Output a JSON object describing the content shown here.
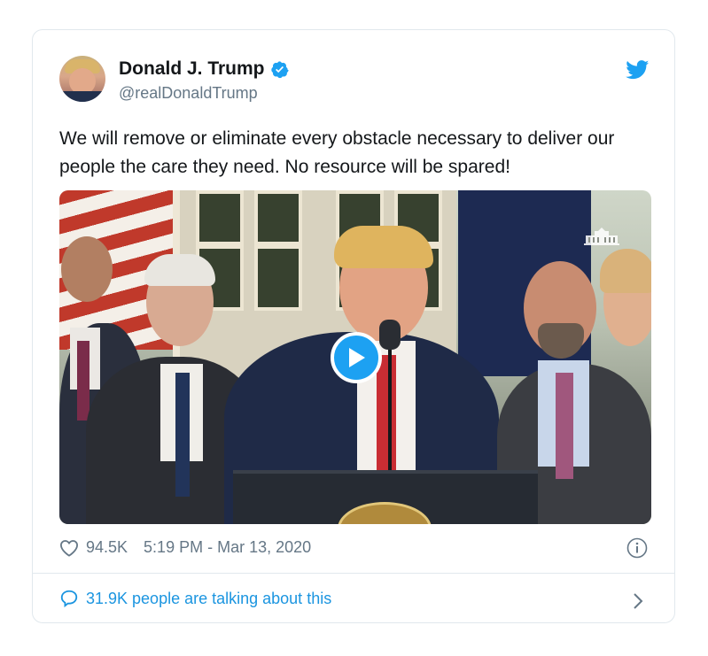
{
  "tweet": {
    "author_name": "Donald J. Trump",
    "author_handle": "@realDonaldTrump",
    "text": "We will remove or eliminate every obstacle necessary to deliver our people the care they need. No resource will be spared!",
    "likes": "94.5K",
    "time": "5:19 PM - Mar 13, 2020",
    "talking": "31.9K people are talking about this",
    "verified": true
  },
  "icons": {
    "verified": "verified-badge-icon",
    "brand": "twitter-bird-icon",
    "like": "heart-icon",
    "info": "info-icon",
    "reply": "speech-bubble-icon",
    "chevron": "chevron-right-icon",
    "play": "play-icon"
  },
  "colors": {
    "accent": "#1da1f2",
    "link": "#1b95e0",
    "muted": "#657786",
    "border": "#e1e8ed",
    "text": "#14171a"
  }
}
